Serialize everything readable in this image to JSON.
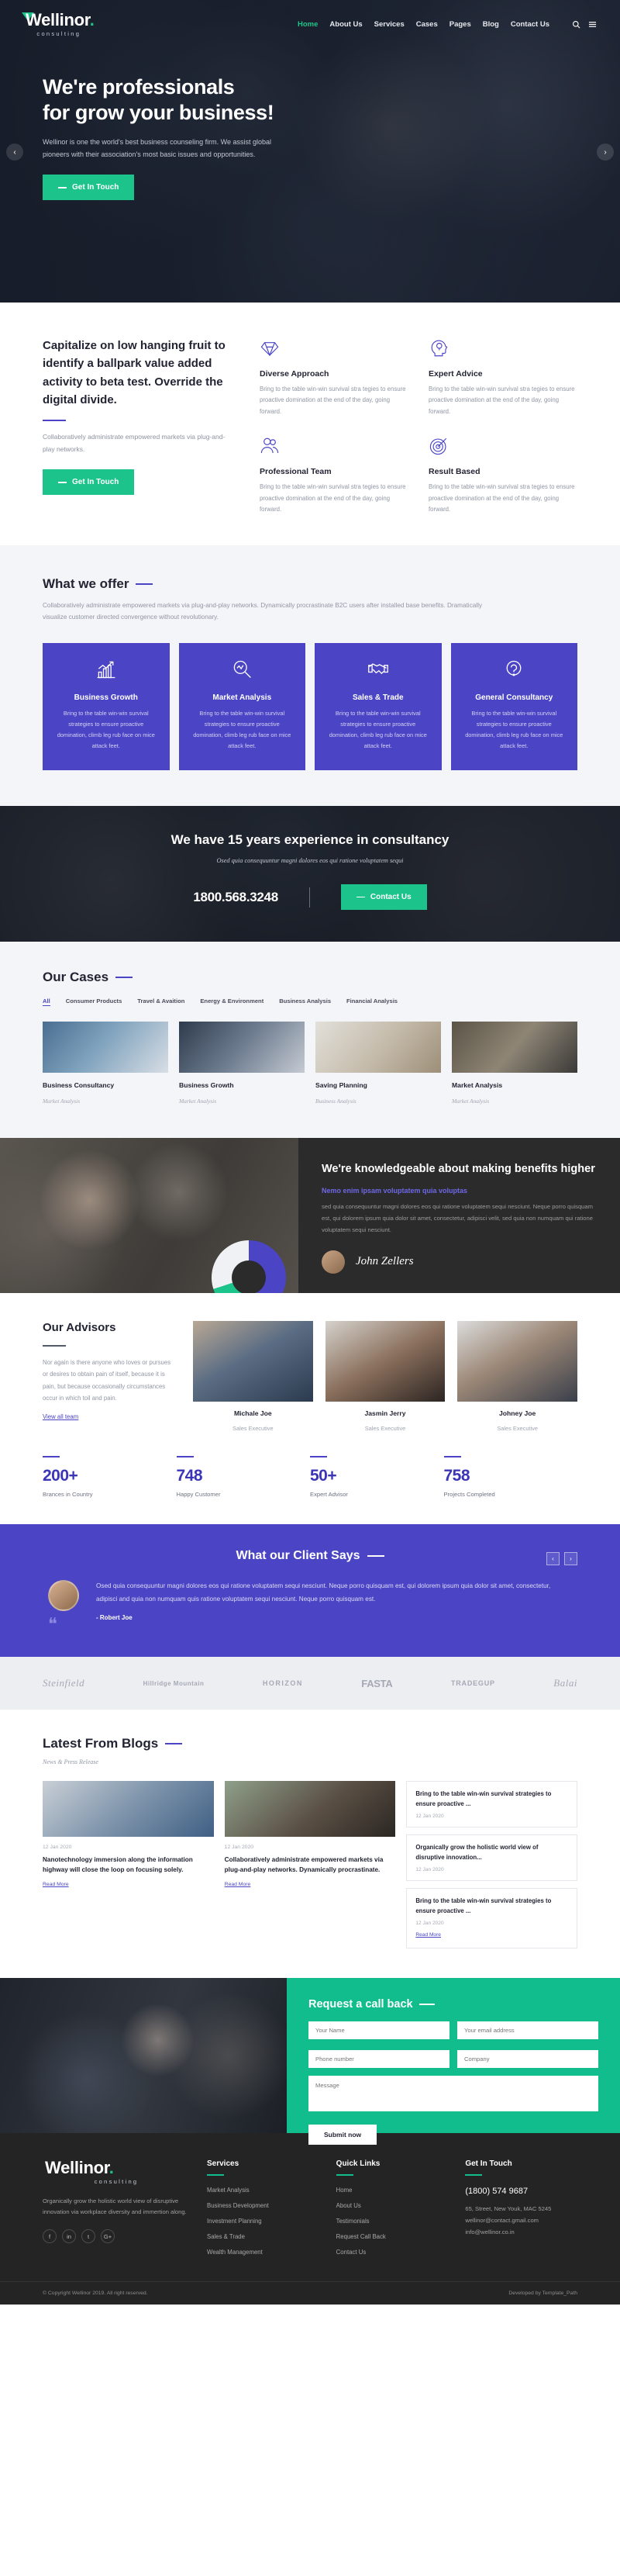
{
  "brand": {
    "name": "Wellinor",
    "sub": "consulting",
    "dot": ".",
    "accent": "#1cc38a",
    "primary": "#4b45c6"
  },
  "nav": {
    "items": [
      {
        "label": "Home",
        "active": true
      },
      {
        "label": "About Us",
        "active": false
      },
      {
        "label": "Services",
        "active": false
      },
      {
        "label": "Cases",
        "active": false
      },
      {
        "label": "Pages",
        "active": false
      },
      {
        "label": "Blog",
        "active": false
      },
      {
        "label": "Contact Us",
        "active": false
      }
    ],
    "search_icon": "search-icon",
    "menu_icon": "hamburger-icon"
  },
  "hero": {
    "title_line1": "We're professionals",
    "title_line2": "for grow your business!",
    "desc": "Wellinor is one the world's best business counseling firm. We assist global pioneers with their association's most basic issues and opportunities.",
    "cta": "Get In Touch",
    "prev": "‹",
    "next": "›"
  },
  "features": {
    "heading": "Capitalize on low hanging fruit to identify a ballpark value added activity to beta test. Override the digital divide.",
    "desc": "Collaboratively administrate empowered markets via plug-and-play networks.",
    "cta": "Get In Touch",
    "items": [
      {
        "icon": "diamond-icon",
        "title": "Diverse Approach",
        "text": "Bring to the table win-win survival stra tegies to ensure proactive domination at the end of the day, going forward."
      },
      {
        "icon": "head-bulb-icon",
        "title": "Expert Advice",
        "text": "Bring to the table win-win survival stra tegies to ensure proactive domination at the end of the day, going forward."
      },
      {
        "icon": "people-icon",
        "title": "Professional Team",
        "text": "Bring to the table win-win survival stra tegies to ensure proactive domination at the end of the day, going forward."
      },
      {
        "icon": "target-icon",
        "title": "Result Based",
        "text": "Bring to the table win-win survival stra tegies to ensure proactive domination at the end of the day, going forward."
      }
    ]
  },
  "offer": {
    "title": "What we offer",
    "desc": "Collaboratively administrate empowered markets via plug-and-play networks. Dynamically procrastinate B2C users after installed base benefits. Dramatically visualize customer directed convergence without revolutionary.",
    "cards": [
      {
        "icon": "growth-chart-icon",
        "title": "Business Growth",
        "text": "Bring to the table win-win survival strategies to ensure proactive domination, climb leg rub face on mice attack feet."
      },
      {
        "icon": "magnifier-icon",
        "title": "Market Analysis",
        "text": "Bring to the table win-win survival strategies to ensure proactive domination, climb leg rub face on mice attack feet."
      },
      {
        "icon": "handshake-icon",
        "title": "Sales & Trade",
        "text": "Bring to the table win-win survival strategies to ensure proactive domination, climb leg rub face on mice attack feet."
      },
      {
        "icon": "consult-icon",
        "title": "General Consultancy",
        "text": "Bring to the table win-win survival strategies to ensure proactive domination, climb leg rub face on mice attack feet."
      }
    ]
  },
  "experience": {
    "title": "We have 15 years experience in consultancy",
    "lead": "Osed quia consequuntur magni dolores eos qui ratione voluptatem sequi",
    "phone": "1800.568.3248",
    "cta": "Contact Us"
  },
  "cases": {
    "title": "Our Cases",
    "filters": [
      {
        "label": "All",
        "active": true
      },
      {
        "label": "Consumer Products",
        "active": false
      },
      {
        "label": "Travel & Avaition",
        "active": false
      },
      {
        "label": "Energy & Environment",
        "active": false
      },
      {
        "label": "Business Analysis",
        "active": false
      },
      {
        "label": "Financial Analysis",
        "active": false
      }
    ],
    "items": [
      {
        "title": "Business Consultancy",
        "cat": "Market Analysis"
      },
      {
        "title": "Business Growth",
        "cat": "Market Analysis"
      },
      {
        "title": "Saving Planning",
        "cat": "Business Analysis"
      },
      {
        "title": "Market Analysis",
        "cat": "Market Analysis"
      }
    ]
  },
  "knowledge": {
    "title": "We're knowledgeable about making benefits higher",
    "highlight": "Nemo enim ipsam voluptatem quia voluptas",
    "text": "sed quia consequuntur magni dolores eos qui ratione voluptatem sequi nesciunt. Neque porro quisquam est, qui dolorem ipsum quia dolor sit amet, consectetur, adipisci velit, sed quia non numquam qui ratione voluptatem sequi nesciunt.",
    "signature": "John Zellers"
  },
  "advisors": {
    "title": "Our Advisors",
    "desc": "Nor again is there anyone who loves or pursues or desires to obtain pain of itself, because it is pain, but because occasionally circumstances occur in which toil and pain.",
    "link": "View all team",
    "members": [
      {
        "name": "Michale Joe",
        "role": "Sales Executive"
      },
      {
        "name": "Jasmin Jerry",
        "role": "Sales Executive"
      },
      {
        "name": "Johney Joe",
        "role": "Sales Executive"
      }
    ]
  },
  "counters": [
    {
      "num": "200+",
      "label": "Brances in Country"
    },
    {
      "num": "748",
      "label": "Happy Customer"
    },
    {
      "num": "50+",
      "label": "Expert Advisor"
    },
    {
      "num": "758",
      "label": "Projects Completed"
    }
  ],
  "testimonial": {
    "title": "What our Client Says",
    "prev": "‹",
    "next": "›",
    "quote_mark": "❝",
    "text": "Osed quia consequuntur magni dolores eos qui ratione voluptatem sequi nesciunt. Neque porro quisquam est, qui dolorem ipsum quia dolor sit amet, consectetur, adipisci and quia non numquam quis ratione voluptatem sequi nesciunt. Neque porro quisquam est.",
    "author": "- Robert Joe"
  },
  "brands": [
    {
      "label": "Steinfield",
      "script": true
    },
    {
      "label": "Hillridge Mountain",
      "script": false
    },
    {
      "label": "HORIZON",
      "script": false
    },
    {
      "label": "FASTA",
      "script": false
    },
    {
      "label": "TRADEGUP",
      "script": false
    },
    {
      "label": "Balai",
      "script": true
    }
  ],
  "blogs": {
    "title": "Latest From Blogs",
    "subtitle": "News & Press Release",
    "posts": [
      {
        "date": "12 Jan 2020",
        "title": "Nanotechnology immersion along the information highway will close the loop on focusing solely.",
        "more": "Read More"
      },
      {
        "date": "12 Jan 2020",
        "title": "Collaboratively administrate empowered markets via plug-and-play networks. Dynamically procrastinate.",
        "more": "Read More"
      }
    ],
    "minis": [
      {
        "title": "Bring to the table win-win survival strategies to ensure proactive ...",
        "date": "12 Jan 2020",
        "more": ""
      },
      {
        "title": "Organically grow the holistic world view of disruptive innovation...",
        "date": "12 Jan 2020",
        "more": ""
      },
      {
        "title": "Bring to the table win-win survival strategies to ensure proactive ...",
        "date": "12 Jan 2020",
        "more": "Read More"
      }
    ]
  },
  "callback": {
    "title": "Request a call back",
    "fields": {
      "first_name": "Your Name",
      "email": "Your email address",
      "phone": "Phone number",
      "company": "Company",
      "message": "Message"
    },
    "submit": "Submit now"
  },
  "footer": {
    "desc": "Organically grow the holistic world view of disruptive innovation via workplace diversity and immertion along.",
    "socials": [
      "f",
      "in",
      "t",
      "G+"
    ],
    "services": {
      "heading": "Services",
      "items": [
        "Market Analysis",
        "Business Development",
        "Investment Planning",
        "Sales & Trade",
        "Wealth Management"
      ]
    },
    "quick": {
      "heading": "Quick Links",
      "items": [
        "Home",
        "About Us",
        "Testimonials",
        "Request Call Back",
        "Contact Us"
      ]
    },
    "touch": {
      "heading": "Get In Touch",
      "phone": "(1800) 574 9687",
      "address": "65, Street, New Youk, MAC 5245",
      "email1": "wellinor@contact.gmail.com",
      "email2": "info@wellinor.co.in"
    },
    "copyright": "© Copyright Wellinor 2019. All right reserved.",
    "credit": "Developed by Template_Path"
  }
}
